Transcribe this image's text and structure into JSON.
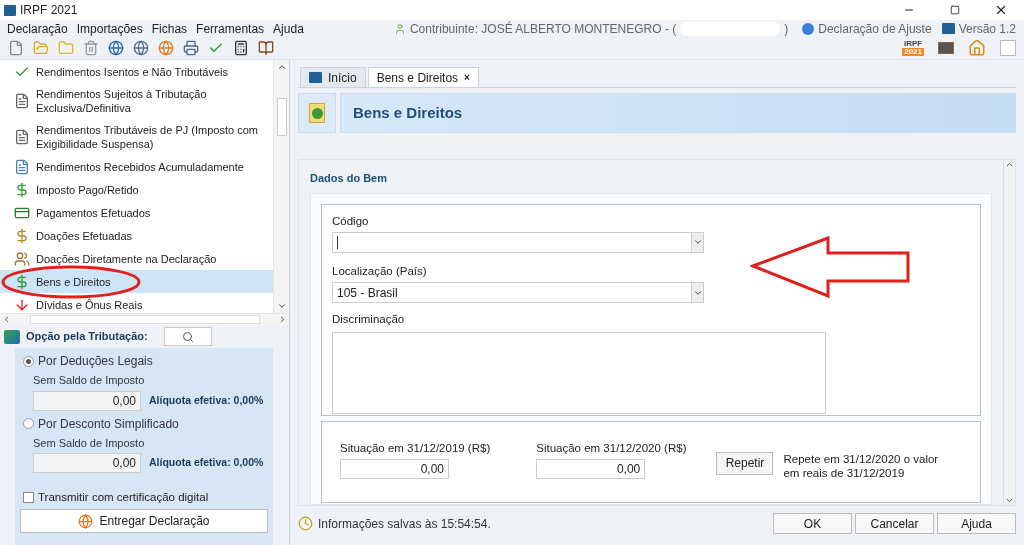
{
  "window": {
    "title": "IRPF 2021"
  },
  "menu": [
    "Declaração",
    "Importações",
    "Fichas",
    "Ferramentas",
    "Ajuda"
  ],
  "header_info": {
    "taxpayer": "Contribuinte: JOSÉ ALBERTO MONTENEGRO - (",
    "taxpayer_end": ")",
    "declaration": "Declaração de Ajuste",
    "version": "Versão 1.2"
  },
  "logo": {
    "line1": "IRPF",
    "line2": "2021"
  },
  "sidebar": {
    "items": [
      {
        "label": "Rendimentos Isentos e Não Tributáveis",
        "selected": false
      },
      {
        "label": "Rendimentos Sujeitos à Tributação Exclusiva/Definitiva",
        "selected": false
      },
      {
        "label": "Rendimentos Tributáveis de PJ (Imposto com Exigibilidade Suspensa)",
        "selected": false
      },
      {
        "label": "Rendimentos Recebidos Acumuladamente",
        "selected": false
      },
      {
        "label": "Imposto Pago/Retido",
        "selected": false
      },
      {
        "label": "Pagamentos Efetuados",
        "selected": false
      },
      {
        "label": "Doações Efetuadas",
        "selected": false
      },
      {
        "label": "Doações Diretamente na Declaração",
        "selected": false
      },
      {
        "label": "Bens e Direitos",
        "selected": true
      },
      {
        "label": "Dívidas e Ônus Reais",
        "selected": false
      }
    ]
  },
  "taxation": {
    "title": "Opção pela Tributação:",
    "options": [
      {
        "label": "Por Deduções Legais",
        "selected": true,
        "status": "Sem Saldo de Imposto",
        "value": "0,00",
        "rate": "Alíquota efetiva: 0,00%"
      },
      {
        "label": "Por Desconto Simplificado",
        "selected": false,
        "status": "Sem Saldo de Imposto",
        "value": "0,00",
        "rate": "Alíquota efetiva: 0,00%"
      }
    ],
    "certificate": {
      "label": "Transmitir com certificação digital",
      "checked": false
    },
    "submit": "Entregar Declaração"
  },
  "tabs": [
    {
      "label": "Início",
      "selected": false
    },
    {
      "label": "Bens e Direitos",
      "selected": true,
      "close": "×"
    }
  ],
  "page_title": "Bens e Direitos",
  "section_title": "Dados do Bem",
  "form": {
    "code_label": "Código",
    "country_label": "Localização (País)",
    "country_value": "105 - Brasil",
    "description_label": "Discriminação",
    "situations": [
      {
        "label": "Situação em 31/12/2019 (R$)",
        "value": "0,00"
      },
      {
        "label": "Situação em 31/12/2020 (R$)",
        "value": "0,00"
      }
    ],
    "repeat_button": "Repetir",
    "repeat_note": "Repete em 31/12/2020 o valor em reais de 31/12/2019"
  },
  "status": "Informações salvas às 15:54:54.",
  "buttons": [
    "OK",
    "Cancelar",
    "Ajuda"
  ]
}
